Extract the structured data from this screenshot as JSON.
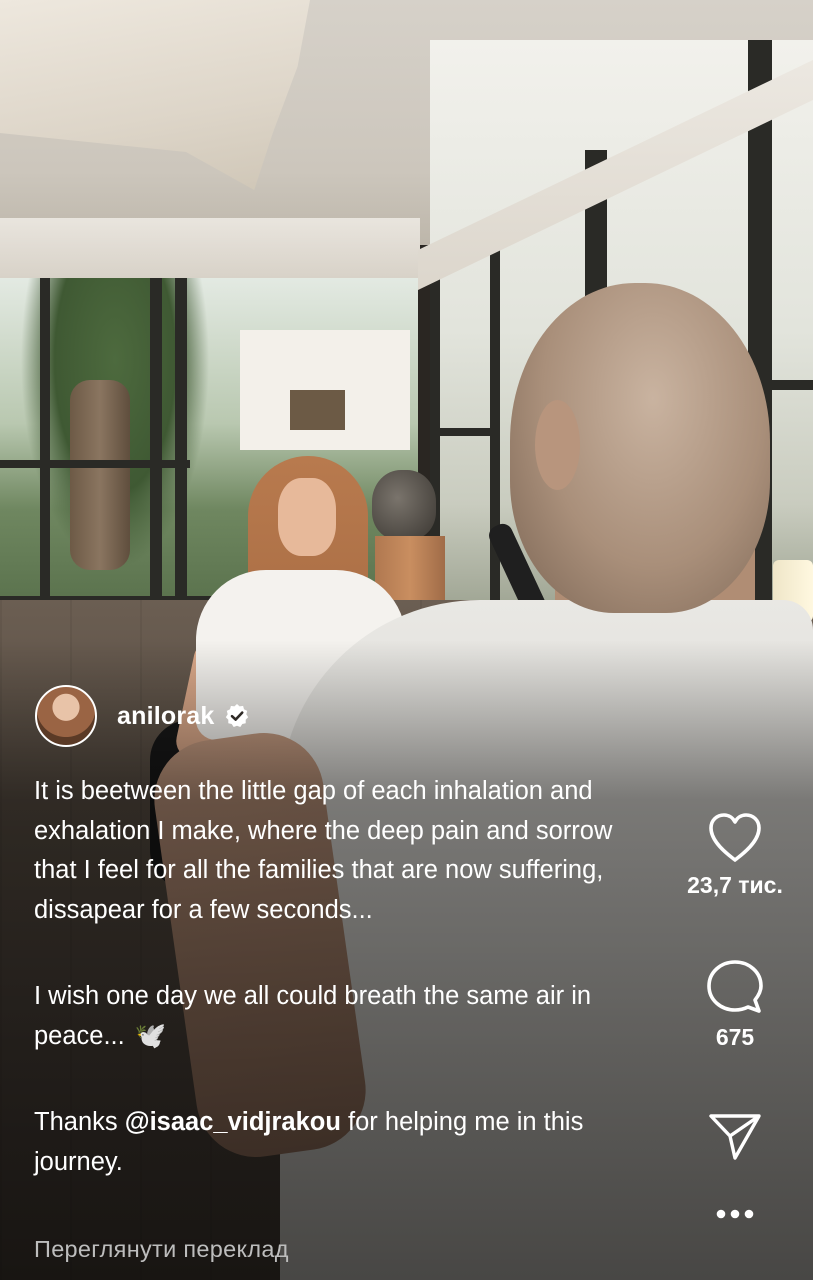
{
  "post": {
    "author": {
      "username": "anilorak",
      "verified": true,
      "avatar_icon": "profile-avatar"
    },
    "caption": {
      "paragraph_1": "It is beetween the little gap of each inhalation and exhalation I make, where the deep pain and sorrow that I feel for all the families that are now suffering, dissapear for a few seconds...",
      "paragraph_2_text": "I wish one day we all could breath the same air in peace...",
      "paragraph_2_emoji": "🕊️",
      "paragraph_3_prefix": "Thanks ",
      "paragraph_3_mention": "@isaac_vidjrakou",
      "paragraph_3_suffix": " for helping me in this journey."
    },
    "translate_link": "Переглянути переклад"
  },
  "actions": {
    "like": {
      "icon": "heart-icon",
      "count": "23,7 тис."
    },
    "comment": {
      "icon": "comment-bubble-icon",
      "count": "675"
    },
    "share": {
      "icon": "paper-plane-icon"
    },
    "more": {
      "icon": "more-horizontal-icon"
    }
  },
  "colors": {
    "overlay_text": "#ffffff",
    "secondary_text": "#bdbdbd"
  }
}
